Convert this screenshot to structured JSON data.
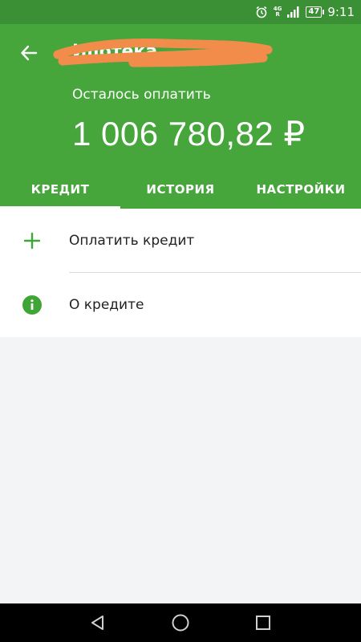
{
  "status_bar": {
    "network_label": "4G",
    "network_sub": "R",
    "battery": "47",
    "time": "9:11"
  },
  "header": {
    "back_icon": "arrow-left-icon",
    "title": "Ипотека",
    "remaining_label": "Осталось оплатить",
    "remaining_amount": "1 006 780,82 ₽"
  },
  "tabs": [
    {
      "label": "КРЕДИТ",
      "active": true
    },
    {
      "label": "ИСТОРИЯ",
      "active": false
    },
    {
      "label": "НАСТРОЙКИ",
      "active": false
    }
  ],
  "list": {
    "items": [
      {
        "label": "Оплатить кредит",
        "icon": "plus-icon"
      },
      {
        "label": "О кредите",
        "icon": "info-icon"
      }
    ]
  },
  "colors": {
    "header_green": "#46a63c",
    "status_green": "#3b8f35",
    "accent_green": "#3fa537",
    "redaction_orange": "#f28c4a"
  }
}
